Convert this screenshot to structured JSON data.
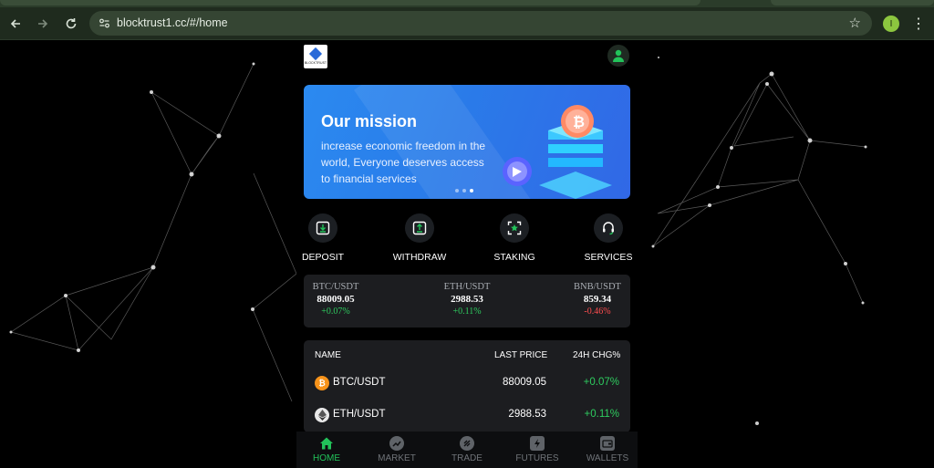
{
  "browser": {
    "url": "blocktrust1.cc/#/home",
    "profile_initial": "I"
  },
  "app": {
    "logo_text": "BLOCKTRUST",
    "banner": {
      "title": "Our mission",
      "text": "increase economic freedom in the world, Everyone deserves access to financial services",
      "slides": 3,
      "active_slide": 3
    },
    "actions": [
      {
        "label": "DEPOSIT",
        "icon": "deposit-icon"
      },
      {
        "label": "WITHDRAW",
        "icon": "withdraw-icon"
      },
      {
        "label": "STAKING",
        "icon": "staking-icon"
      },
      {
        "label": "SERVICES",
        "icon": "headset-icon"
      }
    ],
    "ticker": [
      {
        "pair": "BTC/USDT",
        "price": "88009.05",
        "change": "+0.07%",
        "dir": "up"
      },
      {
        "pair": "ETH/USDT",
        "price": "2988.53",
        "change": "+0.11%",
        "dir": "up"
      },
      {
        "pair": "BNB/USDT",
        "price": "859.34",
        "change": "-0.46%",
        "dir": "down"
      }
    ],
    "market": {
      "headers": {
        "name": "NAME",
        "price": "LAST PRICE",
        "change": "24H CHG%"
      },
      "rows": [
        {
          "name": "BTC/USDT",
          "price": "88009.05",
          "change": "+0.07%",
          "icon": "bitcoin-icon"
        },
        {
          "name": "ETH/USDT",
          "price": "2988.53",
          "change": "+0.11%",
          "icon": "ethereum-icon"
        }
      ]
    },
    "nav": [
      {
        "label": "HOME",
        "icon": "home-icon",
        "active": true
      },
      {
        "label": "MARKET",
        "icon": "market-icon",
        "active": false
      },
      {
        "label": "TRADE",
        "icon": "trade-icon",
        "active": false
      },
      {
        "label": "FUTURES",
        "icon": "futures-icon",
        "active": false
      },
      {
        "label": "WALLETS",
        "icon": "wallet-icon",
        "active": false
      }
    ]
  },
  "colors": {
    "accent_green": "#22c35a",
    "up": "#2ecc5f",
    "down": "#ff4d4f",
    "banner_blue": "#2b8af0",
    "card_bg": "#1c1d20"
  }
}
